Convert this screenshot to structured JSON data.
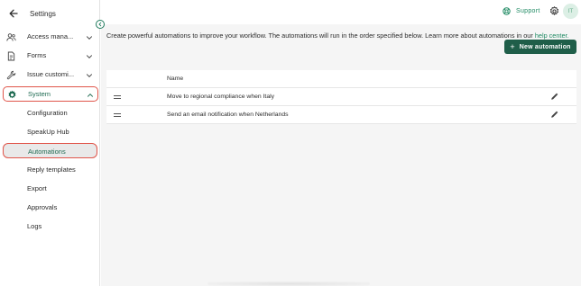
{
  "sidebar": {
    "title": "Settings",
    "items": [
      {
        "label": "Access mana...",
        "icon": "people-icon"
      },
      {
        "label": "Forms",
        "icon": "document-icon"
      },
      {
        "label": "Issue customi...",
        "icon": "wrench-icon"
      },
      {
        "label": "System",
        "icon": "gear-icon"
      }
    ],
    "subitems": [
      {
        "label": "Configuration"
      },
      {
        "label": "SpeakUp Hub"
      },
      {
        "label": "Automations"
      },
      {
        "label": "Reply templates"
      },
      {
        "label": "Export"
      },
      {
        "label": "Approvals"
      },
      {
        "label": "Logs"
      }
    ]
  },
  "topbar": {
    "support_label": "Support",
    "avatar_initials": "IT"
  },
  "main": {
    "intro_text": "Create powerful automations to improve your workflow. The automations will run in the order specified below. Learn more about automations in our ",
    "intro_link": "help center.",
    "new_button_label": "New automation",
    "table": {
      "header_name": "Name",
      "rows": [
        {
          "name": "Move to regional compliance when Italy"
        },
        {
          "name": "Send an email notification when Netherlands"
        }
      ]
    }
  },
  "colors": {
    "accent": "#1f5e49",
    "link": "#1f8a63",
    "highlight_border": "#e0554a",
    "selected_bg": "#e9e9e9"
  }
}
